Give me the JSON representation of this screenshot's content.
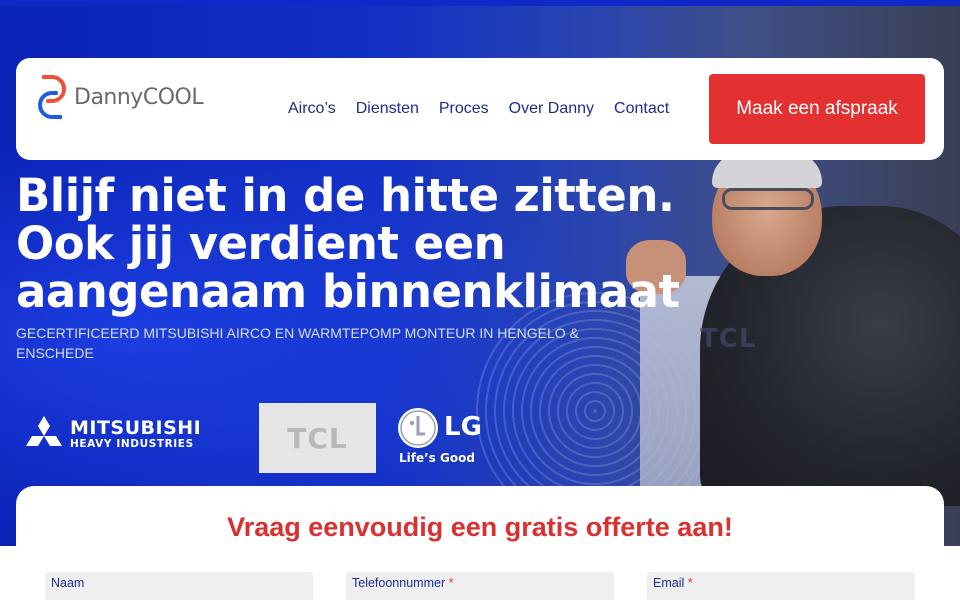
{
  "brand": {
    "logo_text": "DannyCOOL",
    "accent_color": "#e33131",
    "nav_color": "#1d2b8f",
    "hero_blue": "#1230c4"
  },
  "nav": {
    "items": [
      {
        "label": "Airco’s"
      },
      {
        "label": "Diensten"
      },
      {
        "label": "Proces"
      },
      {
        "label": "Over Danny"
      },
      {
        "label": "Contact"
      }
    ],
    "cta_label": "Maak een afspraak"
  },
  "hero": {
    "headline_lines": [
      "Blijf niet in de hitte zitten.",
      "Ook jij verdient een",
      "aangenaam binnenklimaat"
    ],
    "subline": "GECERTIFICEERD MITSUBISHI AIRCO EN WARMTEPOMP MONTEUR IN HENGELO & ENSCHEDE",
    "photo_unit_brand": "TCL"
  },
  "partners": {
    "mitsubishi_line1": "MITSUBISHI",
    "mitsubishi_line2": "HEAVY INDUSTRIES",
    "tcl": "TCL",
    "lg": "LG",
    "lg_tagline": "Life’s Good"
  },
  "form": {
    "title": "Vraag eenvoudig een gratis offerte aan!",
    "fields": [
      {
        "label": "Naam",
        "required": false
      },
      {
        "label": "Telefoonnummer",
        "required": true
      },
      {
        "label": "Email",
        "required": true
      }
    ],
    "required_marker": "*"
  }
}
